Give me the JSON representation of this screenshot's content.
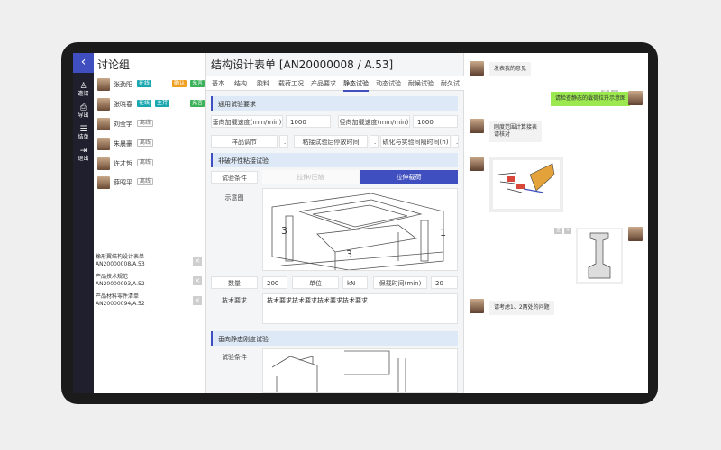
{
  "rail": {
    "items": [
      {
        "icon": "person-icon",
        "label": "邀请"
      },
      {
        "icon": "export-icon",
        "label": "导出"
      },
      {
        "icon": "conclude-icon",
        "label": "结单"
      },
      {
        "icon": "logout-icon",
        "label": "退出"
      }
    ]
  },
  "group": {
    "title": "讨论组",
    "members": [
      {
        "name": "张劲阳",
        "tags": [
          "在线",
          "确认",
          "允言"
        ]
      },
      {
        "name": "张晓春",
        "tags": [
          "在线",
          "主持",
          "允言"
        ]
      },
      {
        "name": "刘莹宇",
        "tags": [
          "离线"
        ]
      },
      {
        "name": "朱晨豪",
        "tags": [
          "离线"
        ]
      },
      {
        "name": "许才哲",
        "tags": [
          "离线"
        ]
      },
      {
        "name": "薛昭平",
        "tags": [
          "离线"
        ]
      }
    ],
    "docs": [
      {
        "title": "橡形翼结构设计表单",
        "code": "AN20000008/A.53"
      },
      {
        "title": "产品技术规范",
        "code": "AN20000093/A.52"
      },
      {
        "title": "产品材料零件清单",
        "code": "AN20000094/A.52"
      }
    ]
  },
  "form": {
    "title": "结构设计表单 [AN20000008 / A.53]",
    "tabs": [
      "基本",
      "结构",
      "胶料",
      "载荷工况",
      "产品要求",
      "静态试验",
      "动态试验",
      "耐候试验",
      "耐久试"
    ],
    "active_tab": "静态试验",
    "sec1": {
      "title": "通用试验要求",
      "vert_speed_label": "垂向加载速度(mm/min)",
      "vert_speed_value": "1000",
      "rad_speed_label": "径向加载速度(mm/min)",
      "rad_speed_value": "1000",
      "sample_label": "样品调节",
      "sample_value": ".",
      "bond_label": "粘接试验后停放时间",
      "bond_value": ".",
      "cure_label": "硫化与实验间隔时间(h)",
      "cure_value": "."
    },
    "sec2": {
      "title": "非破坏性粘接试验",
      "cond_label": "试验条件",
      "opt_a": "拉伸/压缩",
      "opt_b": "拉伸载荷",
      "diagram_label": "示意图",
      "callouts": [
        "3",
        "1",
        "3"
      ],
      "qty_label": "数量",
      "qty_value": "200",
      "unit_label": "单位",
      "unit_value": "kN",
      "hold_label": "保载时间(min)",
      "hold_value": "20",
      "tech_label": "技术要求",
      "tech_value": "技术要求技术要求技术要求技术要求"
    },
    "sec3": {
      "title": "垂向静态刚度试验",
      "cond_label": "试验条件"
    }
  },
  "chat": {
    "messages": [
      {
        "side": "left",
        "text": "发表我的意见"
      },
      {
        "side": "right",
        "text": "请检查静态的载荷拉升示意图",
        "actions": [
          "查",
          "+"
        ]
      },
      {
        "side": "left",
        "text": "刚度范围计算接表\n请核对"
      },
      {
        "side": "left",
        "type": "image"
      },
      {
        "side": "right",
        "type": "image",
        "actions": [
          "查",
          "+"
        ]
      },
      {
        "side": "left",
        "text": "请考虑1、2两处的问题"
      }
    ]
  },
  "colors": {
    "accent": "#3f4fbf",
    "online": "#19a7b0",
    "bubble_me": "#9be84f",
    "section_bg": "#dde9f7"
  }
}
